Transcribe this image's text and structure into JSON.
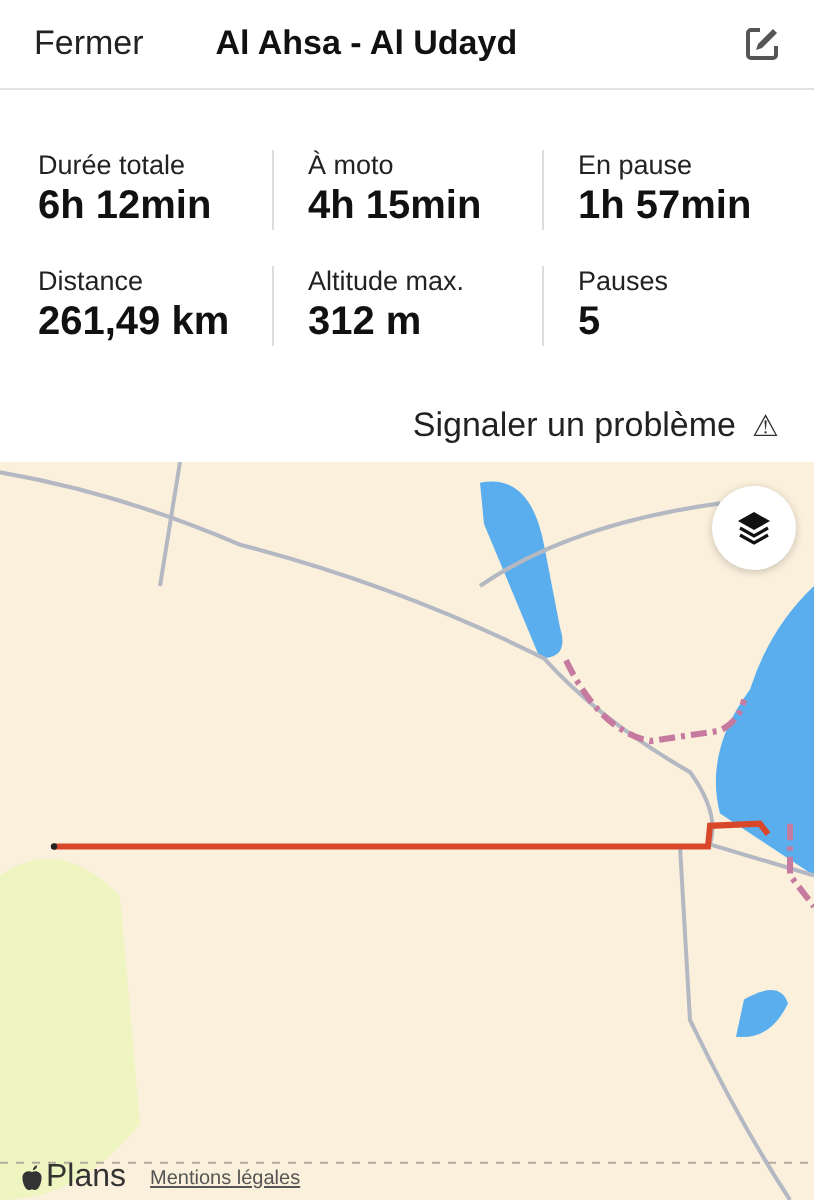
{
  "header": {
    "close": "Fermer",
    "title": "Al Ahsa - Al Udayd"
  },
  "stats": [
    {
      "label": "Durée totale",
      "value": "6h 12min"
    },
    {
      "label": "À moto",
      "value": "4h 15min"
    },
    {
      "label": "En pause",
      "value": "1h 57min"
    },
    {
      "label": "Distance",
      "value": "261,49 km"
    },
    {
      "label": "Altitude max.",
      "value": "312 m"
    },
    {
      "label": "Pauses",
      "value": "5"
    }
  ],
  "report": {
    "label": "Signaler un problème",
    "icon": "⚠"
  },
  "map": {
    "kind": "picture",
    "brand": "Plans",
    "legal": "Mentions légales"
  }
}
